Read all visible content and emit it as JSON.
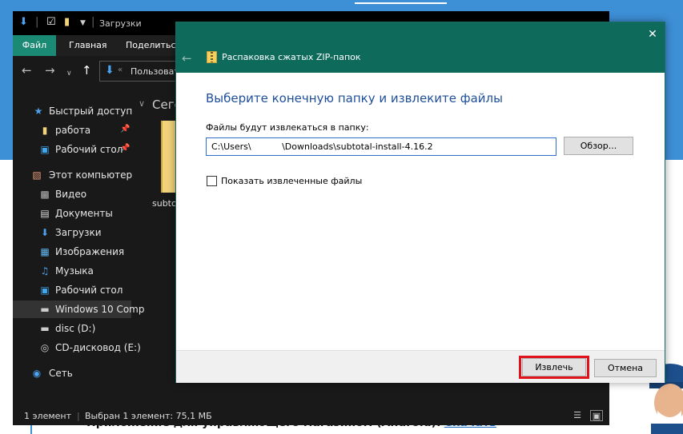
{
  "colors": {
    "explorer_bg": "#191919",
    "ribbon_accent": "#1b8a74",
    "dialog_titlebar": "#0e6b5c",
    "heading": "#1f4f9a",
    "highlight": "#e0121c",
    "web_blue": "#3d8fd6"
  },
  "background_page": {
    "text": "Приложение для управляющего магазином (Android):",
    "link": "Скачать"
  },
  "explorer": {
    "title": "Загрузки",
    "ribbon_tabs": [
      "Файл",
      "Главная",
      "Поделиться"
    ],
    "address": "Пользовате",
    "sidebar": [
      {
        "label": "Быстрый доступ",
        "icon": "star-icon"
      },
      {
        "label": "работа",
        "icon": "folder-icon",
        "pinned": true
      },
      {
        "label": "Рабочий стол",
        "icon": "desktop-icon",
        "pinned": true
      },
      {
        "label": "Этот компьютер",
        "icon": "computer-icon"
      },
      {
        "label": "Видео",
        "icon": "video-icon"
      },
      {
        "label": "Документы",
        "icon": "documents-icon"
      },
      {
        "label": "Загрузки",
        "icon": "downloads-icon"
      },
      {
        "label": "Изображения",
        "icon": "pictures-icon"
      },
      {
        "label": "Музыка",
        "icon": "music-icon"
      },
      {
        "label": "Рабочий стол",
        "icon": "desktop-icon"
      },
      {
        "label": "Windows 10 Comp",
        "icon": "drive-icon",
        "selected": true
      },
      {
        "label": "disc (D:)",
        "icon": "drive-icon"
      },
      {
        "label": "CD-дисковод (E:)",
        "icon": "cd-drive-icon"
      },
      {
        "label": "Сеть",
        "icon": "network-icon"
      }
    ],
    "section_title": "Сегод",
    "file_name": "subtc",
    "status": {
      "count": "1 элемент",
      "selected": "Выбран 1 элемент: 75,1 МБ"
    }
  },
  "dialog": {
    "title": "Распаковка сжатых ZIP-папок",
    "heading": "Выберите конечную папку и извлеките файлы",
    "path_label": "Файлы будут извлекаться в папку:",
    "path_value": "C:\\Users\\           \\Downloads\\subtotal-install-4.16.2",
    "browse_label": "Обзор...",
    "show_files_label": "Показать извлеченные файлы",
    "show_files_checked": false,
    "extract_label": "Извлечь",
    "cancel_label": "Отмена"
  }
}
